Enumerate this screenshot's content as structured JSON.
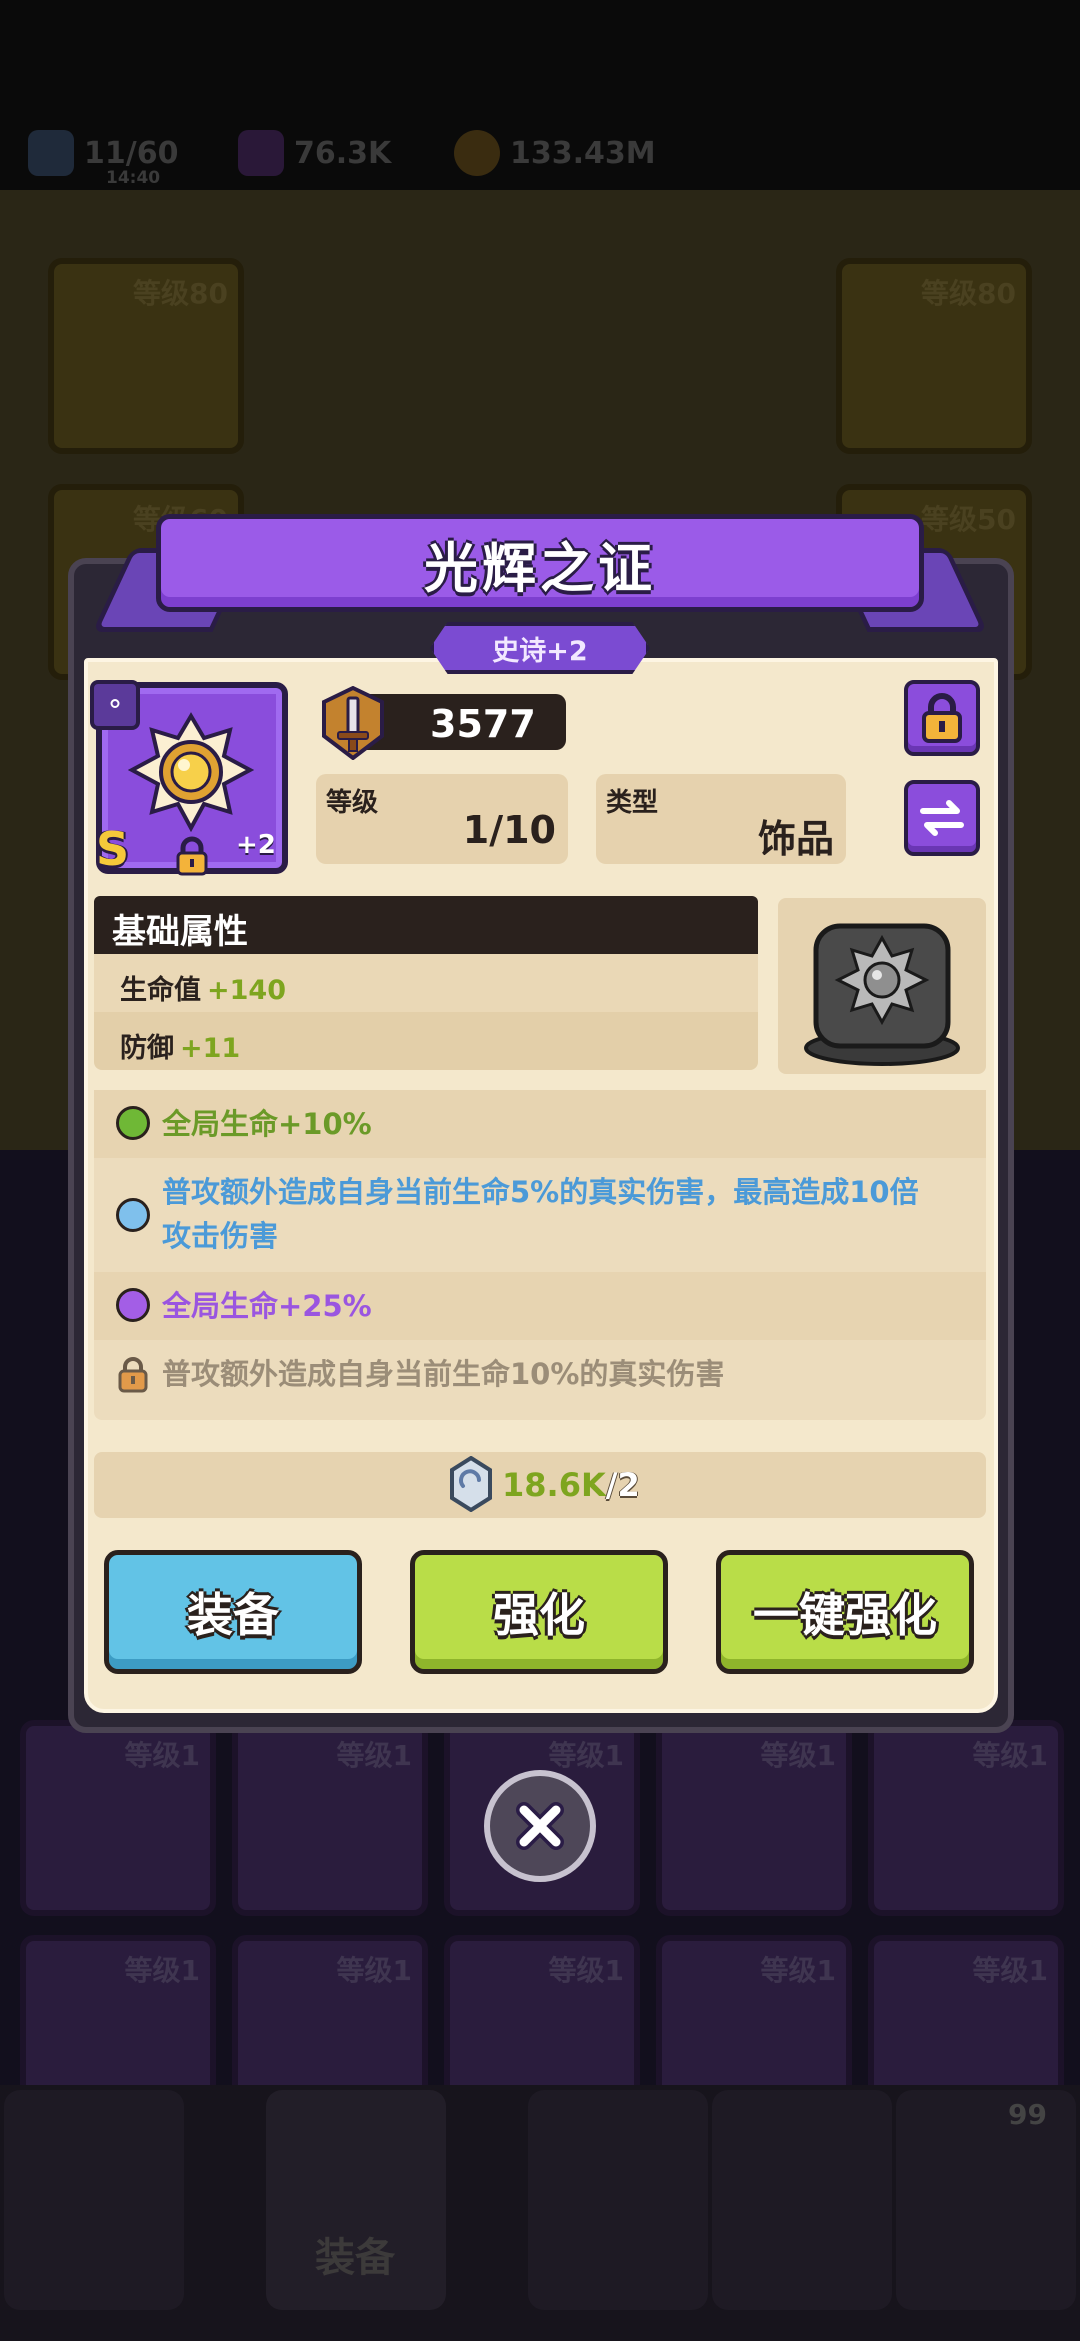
{
  "resources": {
    "energy": "11/60",
    "energy_timer": "14:40",
    "gems": "76.3K",
    "coins": "133.43M"
  },
  "background": {
    "equip_levels": [
      "等级80",
      "等级80",
      "等级60",
      "等级50"
    ],
    "inventory_level": "等级1",
    "nav_active_label": "装备",
    "nav_badge_count": "99"
  },
  "item": {
    "name": "光辉之证",
    "rarity": "史诗+2",
    "grade": "S",
    "plus": "+2",
    "power": "3577",
    "level_label": "等级",
    "level_value": "1/10",
    "type_label": "类型",
    "type_value": "饰品"
  },
  "base_attributes": {
    "heading": "基础属性",
    "rows": [
      {
        "name": "生命值",
        "value": "+140"
      },
      {
        "name": "防御",
        "value": "+11"
      }
    ]
  },
  "effects": [
    {
      "text": "全局生命+10%",
      "color": "green"
    },
    {
      "text": "普攻额外造成自身当前生命5%的真实伤害，最高造成10倍攻击伤害",
      "line1": "普攻额外造成自身当前生命5%的真实伤害，最高造成10倍",
      "line2": "攻击伤害",
      "color": "blue"
    },
    {
      "text": "全局生命+25%",
      "color": "purple"
    },
    {
      "text": "普攻额外造成自身当前生命10%的真实伤害",
      "color": "locked"
    }
  ],
  "cost": {
    "amount": "18.6K",
    "required": "/2"
  },
  "buttons": {
    "equip": "装备",
    "upgrade": "强化",
    "auto_upgrade": "一键强化"
  },
  "colors": {
    "green": "#6b9a28",
    "blue": "#4b9ad8",
    "purple": "#9a55e0",
    "locked": "#9b8d78",
    "ribbon": "#9b5be8"
  }
}
